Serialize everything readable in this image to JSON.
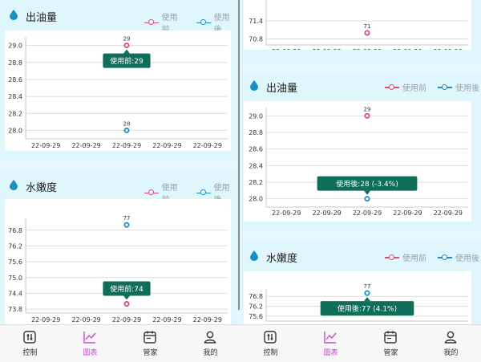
{
  "colors": {
    "before": "#e0457b",
    "after": "#1a8fc4",
    "tooltip": "#0f6e5a",
    "active_tab": "#c44fd0"
  },
  "legend": {
    "before": "使用前",
    "after": "使用後"
  },
  "left": {
    "chart_data": [
      {
        "type": "scatter",
        "title": "出油量",
        "x": [
          "22-09-29",
          "22-09-29",
          "22-09-29",
          "22-09-29",
          "22-09-29"
        ],
        "y_ticks": [
          "29.0",
          "28.8",
          "28.6",
          "28.4",
          "28.2",
          "28.0"
        ],
        "ylim": [
          27.9,
          29.1
        ],
        "series": [
          {
            "name": "使用前",
            "point_index": 2,
            "value": 29,
            "label": "29"
          },
          {
            "name": "使用後",
            "point_index": 2,
            "value": 28,
            "label": "28"
          }
        ],
        "tooltip": "使用前:29"
      },
      {
        "type": "scatter",
        "title": "水嫩度",
        "x": [
          "22-09-29",
          "22-09-29",
          "22-09-29",
          "22-09-29",
          "22-09-29"
        ],
        "y_ticks": [
          "76.8",
          "76.2",
          "75.6",
          "75.0",
          "74.4",
          "73.8"
        ],
        "ylim": [
          73.65,
          77.25
        ],
        "series": [
          {
            "name": "使用前",
            "point_index": 2,
            "value": 74,
            "label": ""
          },
          {
            "name": "使用後",
            "point_index": 2,
            "value": 77,
            "label": "77"
          }
        ],
        "tooltip": "使用前:74"
      }
    ]
  },
  "right": {
    "chart_data": [
      {
        "type": "scatter",
        "title": "",
        "x": [
          "22-09-29",
          "22-09-29",
          "22-09-29",
          "22-09-29",
          "22-09-29"
        ],
        "y_ticks": [
          "71.4",
          "70.8"
        ],
        "ylim": [
          70.6,
          72.2
        ],
        "series": [
          {
            "name": "使用前",
            "point_index": 2,
            "value": 71,
            "label": "71"
          }
        ],
        "tooltip": ""
      },
      {
        "type": "scatter",
        "title": "出油量",
        "x": [
          "22-09-29",
          "22-09-29",
          "22-09-29",
          "22-09-29",
          "22-09-29"
        ],
        "y_ticks": [
          "29.0",
          "28.8",
          "28.6",
          "28.4",
          "28.2",
          "28.0"
        ],
        "ylim": [
          27.9,
          29.1
        ],
        "series": [
          {
            "name": "使用前",
            "point_index": 2,
            "value": 29,
            "label": "29"
          },
          {
            "name": "使用後",
            "point_index": 2,
            "value": 28,
            "label": ""
          }
        ],
        "tooltip": "使用後:28 (-3.4%)"
      },
      {
        "type": "scatter",
        "title": "水嫩度",
        "x": [],
        "y_ticks": [
          "76.8",
          "76.2",
          "75.6"
        ],
        "ylim": [
          75.3,
          77.25
        ],
        "series": [
          {
            "name": "使用後",
            "point_index": 2,
            "value": 77,
            "label": "77"
          }
        ],
        "tooltip": "使用後:77 (4.1%)"
      }
    ]
  },
  "tabs": [
    {
      "label": "控制",
      "icon": "sliders-icon"
    },
    {
      "label": "圖表",
      "icon": "chart-icon"
    },
    {
      "label": "管家",
      "icon": "calendar-icon"
    },
    {
      "label": "我的",
      "icon": "user-icon"
    }
  ]
}
